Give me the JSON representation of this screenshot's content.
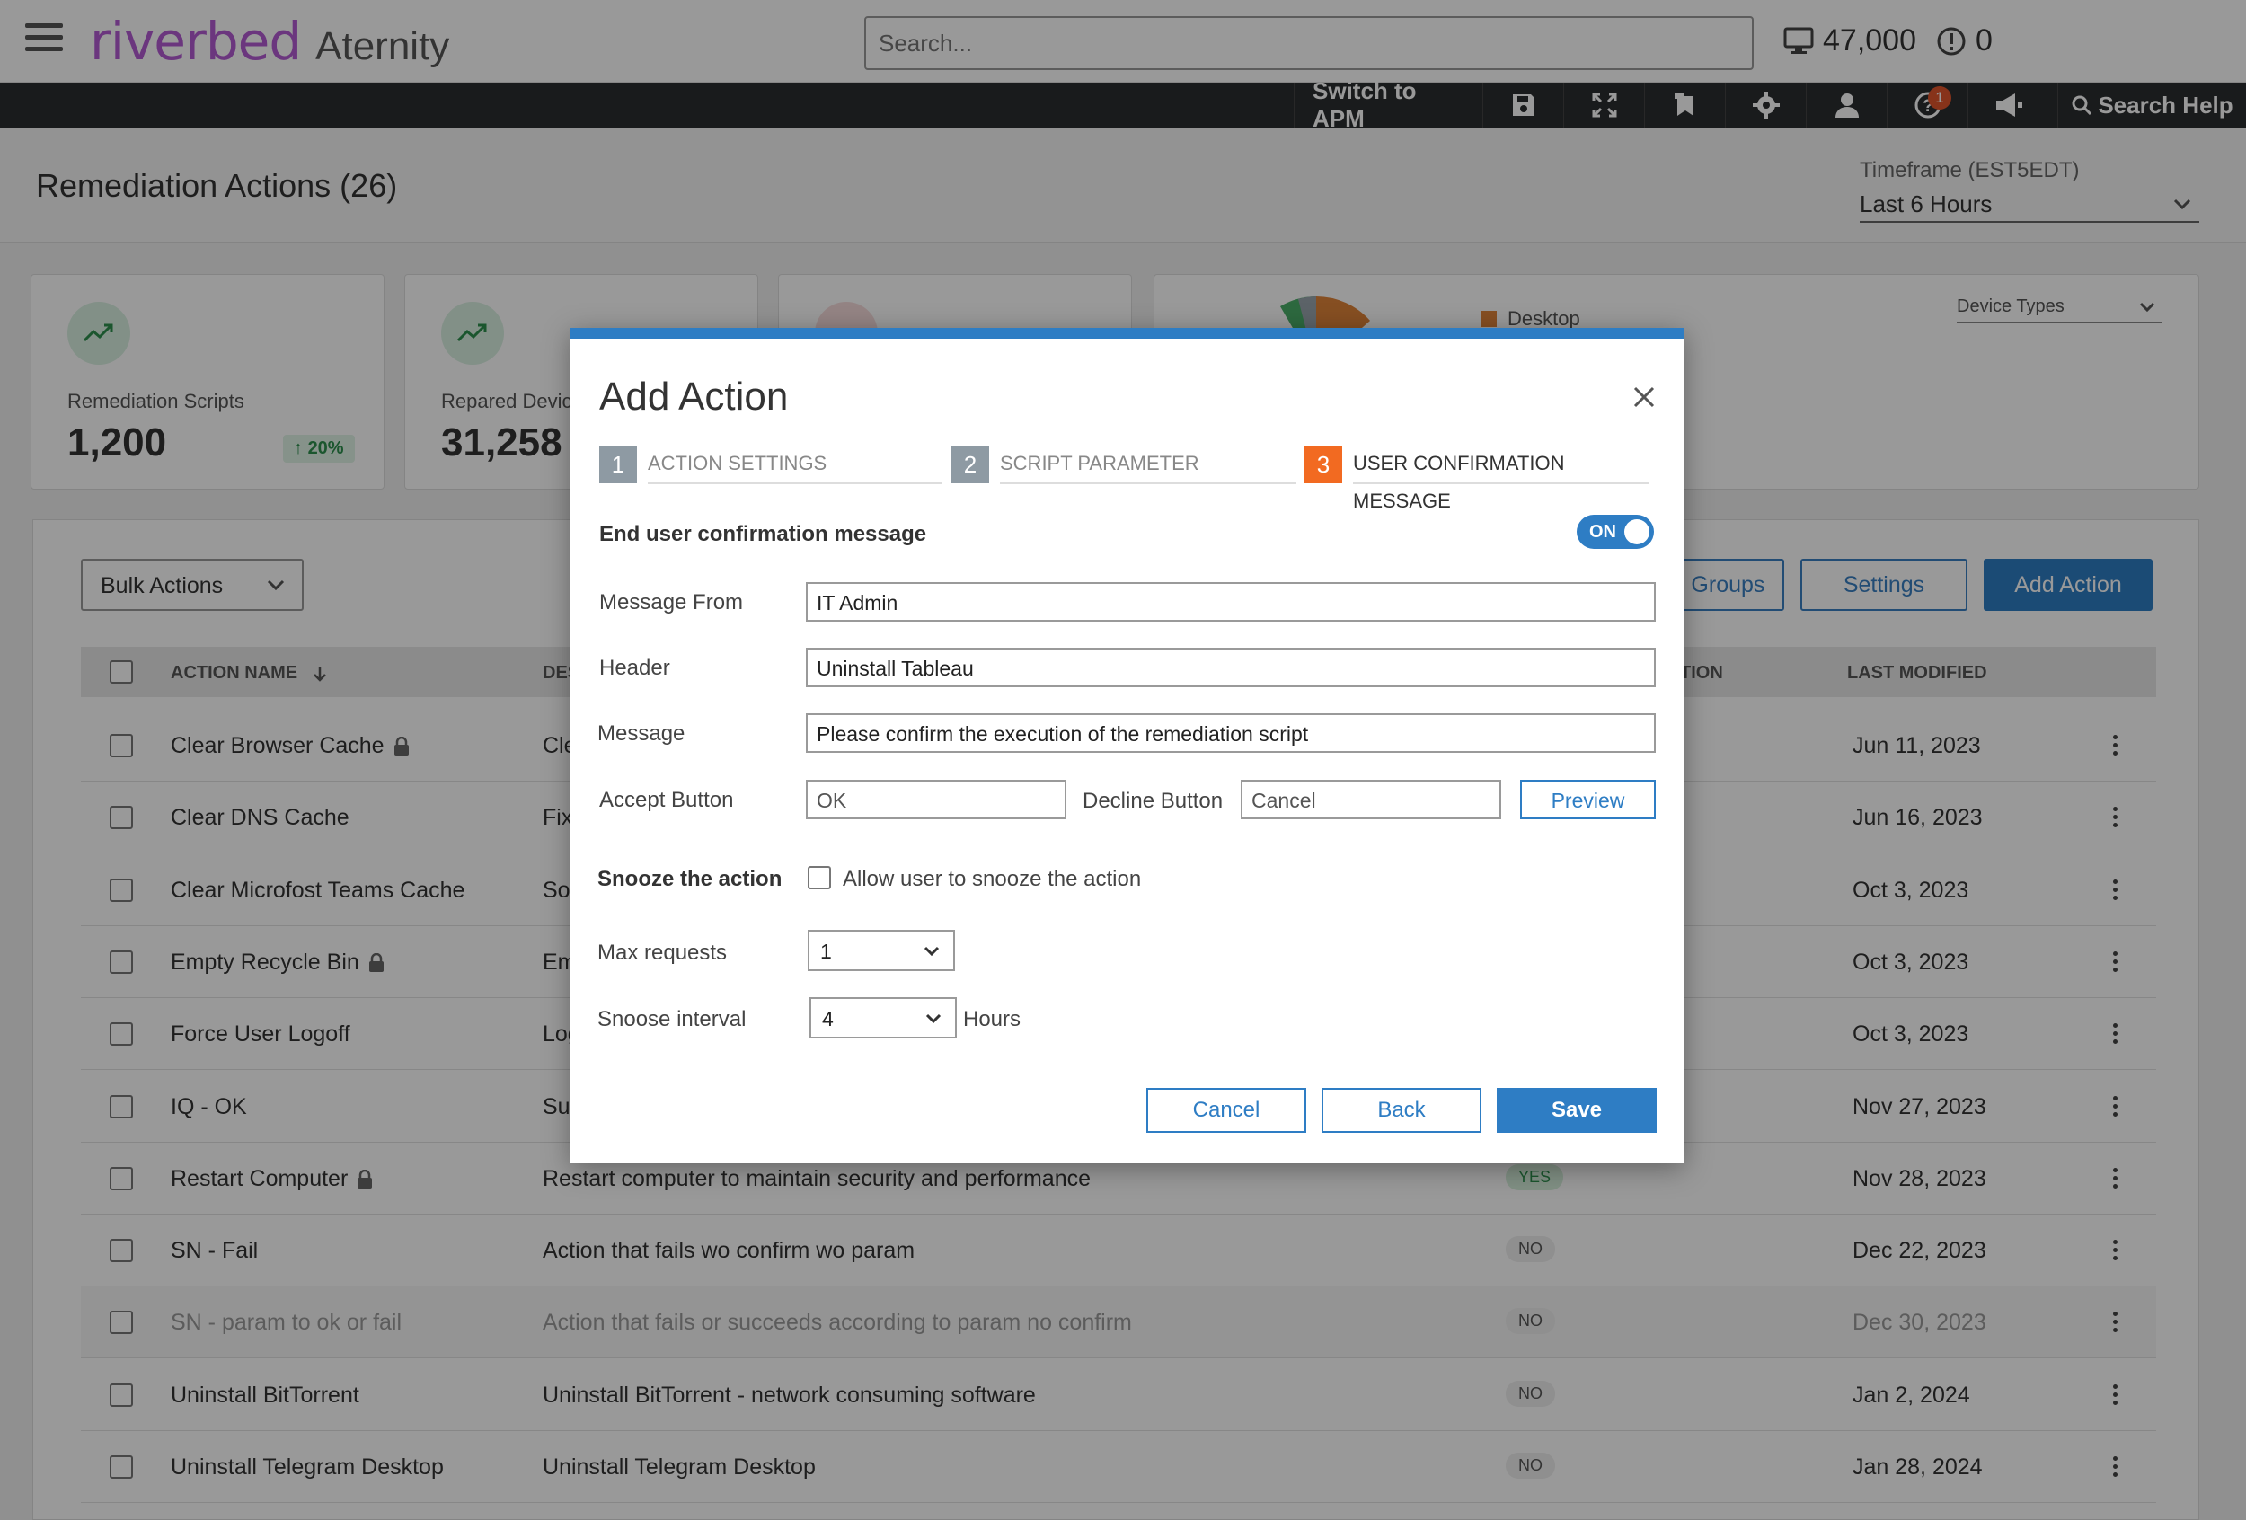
{
  "app": {
    "brand": "riverbed",
    "product": "Aternity",
    "search_placeholder": "Search...",
    "devices_count": "47,000",
    "alerts_count": "0"
  },
  "toolbar": {
    "switch_label": "Switch to APM",
    "help_badge": "1",
    "search_help_label": "Search Help",
    "icons": [
      "save-icon",
      "fullscreen-icon",
      "bookmark-icon",
      "gear-icon",
      "user-icon",
      "help-icon",
      "megaphone-icon",
      "search-icon"
    ]
  },
  "page": {
    "title": "Remediation Actions (26)",
    "timeframe_label": "Timeframe (EST5EDT)",
    "timeframe_value": "Last 6 Hours"
  },
  "kpis": [
    {
      "label": "Remediation Scripts",
      "value": "1,200",
      "delta": "20%"
    },
    {
      "label": "Repared Device",
      "value": "31,258"
    }
  ],
  "device_types": {
    "legend": "Desktop",
    "select_label": "Device Types"
  },
  "table_toolbar": {
    "bulk_actions": "Bulk Actions",
    "groups_label": "e Groups",
    "settings_label": "Settings",
    "add_action_label": "Add Action"
  },
  "table": {
    "headers": {
      "name": "ACTION NAME",
      "desc": "DES",
      "confirm": "TION",
      "modified": "LAST MODIFIED"
    },
    "rows": [
      {
        "name": "Clear Browser Cache",
        "desc": "Cle",
        "confirm": "",
        "date": "Jun 11, 2023",
        "locked": true
      },
      {
        "name": "Clear DNS Cache",
        "desc": "Fix",
        "confirm": "",
        "date": "Jun 16, 2023",
        "locked": false
      },
      {
        "name": "Clear Microfost Teams Cache",
        "desc": "Sol",
        "confirm": "",
        "date": "Oct 3, 2023",
        "locked": false
      },
      {
        "name": "Empty Recycle Bin",
        "desc": "Em",
        "confirm": "",
        "date": "Oct 3, 2023",
        "locked": true
      },
      {
        "name": "Force User Logoff",
        "desc": "Log",
        "confirm": "",
        "date": "Oct 3, 2023",
        "locked": false
      },
      {
        "name": "IQ - OK",
        "desc": "Suc",
        "confirm": "",
        "date": "Nov 27, 2023",
        "locked": false
      },
      {
        "name": "Restart Computer",
        "desc": "Restart computer to maintain security and performance",
        "confirm": "YES",
        "date": "Nov 28, 2023",
        "locked": true
      },
      {
        "name": "SN - Fail",
        "desc": "Action that fails wo confirm wo param",
        "confirm": "NO",
        "date": "Dec 22, 2023",
        "locked": false
      },
      {
        "name": "SN - param to ok or fail",
        "desc": "Action that fails or succeeds according to param no confirm",
        "confirm": "NO",
        "date": "Dec 30, 2023",
        "locked": false
      },
      {
        "name": "Uninstall BitTorrent",
        "desc": "Uninstall BitTorrent - network consuming software",
        "confirm": "NO",
        "date": "Jan 2, 2024",
        "locked": false
      },
      {
        "name": "Uninstall Telegram Desktop",
        "desc": "Uninstall Telegram Desktop",
        "confirm": "NO",
        "date": "Jan 28, 2024",
        "locked": false
      }
    ]
  },
  "modal": {
    "title": "Add Action",
    "steps": [
      {
        "num": "1",
        "label": "ACTION SETTINGS"
      },
      {
        "num": "2",
        "label": "SCRIPT PARAMETER"
      },
      {
        "num": "3",
        "label": "USER CONFIRMATION MESSAGE"
      }
    ],
    "confirm_label": "End user confirmation message",
    "toggle_label": "ON",
    "message_from_label": "Message From",
    "message_from_value": "IT Admin",
    "header_label": "Header",
    "header_value": "Uninstall Tableau",
    "message_label": "Message",
    "message_value": "Please confirm the execution of the remediation script",
    "accept_label": "Accept Button",
    "accept_value": "OK",
    "decline_label": "Decline Button",
    "decline_value": "Cancel",
    "preview_label": "Preview",
    "snooze_label": "Snooze the action",
    "snooze_check_label": "Allow user to snooze the action",
    "max_requests_label": "Max requests",
    "max_requests_value": "1",
    "interval_label": "Snoose interval",
    "interval_value": "4",
    "interval_unit": "Hours",
    "cancel_label": "Cancel",
    "back_label": "Back",
    "save_label": "Save"
  }
}
